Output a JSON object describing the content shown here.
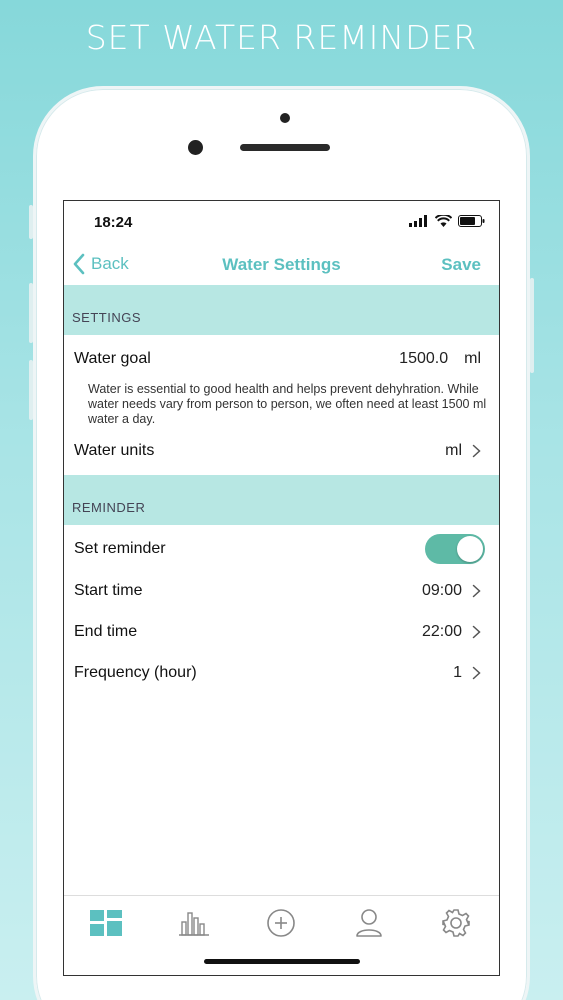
{
  "promo": {
    "title": "SET WATER REMINDER"
  },
  "status_bar": {
    "time": "18:24"
  },
  "nav": {
    "back_label": "Back",
    "title": "Water Settings",
    "save_label": "Save"
  },
  "settings": {
    "header": "SETTINGS",
    "water_goal": {
      "label": "Water goal",
      "value": "1500.0",
      "unit": "ml"
    },
    "description": "Water is essential to good health and helps prevent dehyhration. While water needs vary from person to person, we often need at least 1500 ml water a day.",
    "water_units": {
      "label": "Water units",
      "value": "ml"
    }
  },
  "reminder": {
    "header": "REMINDER",
    "set_reminder": {
      "label": "Set reminder",
      "enabled": true
    },
    "start_time": {
      "label": "Start time",
      "value": "09:00"
    },
    "end_time": {
      "label": "End time",
      "value": "22:00"
    },
    "frequency": {
      "label": "Frequency (hour)",
      "value": "1"
    }
  },
  "tabs": [
    {
      "icon": "dashboard-icon",
      "active": true
    },
    {
      "icon": "bar-chart-icon",
      "active": false
    },
    {
      "icon": "plus-circle-icon",
      "active": false
    },
    {
      "icon": "user-icon",
      "active": false
    },
    {
      "icon": "gear-icon",
      "active": false
    }
  ],
  "colors": {
    "accent": "#5cc0c0",
    "section_bg": "#b7e7e3",
    "toggle_on": "#5ebaa6"
  }
}
